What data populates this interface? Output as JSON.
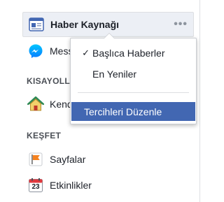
{
  "sidebar": {
    "news_feed": {
      "label": "Haber Kaynağı",
      "more": "•••"
    },
    "messenger": {
      "label": "Messenger"
    },
    "shortcuts_title": "KISAYOLLAR",
    "shortcut_item": {
      "label": "Kendin"
    },
    "explore_title": "KEŞFET",
    "pages": {
      "label": "Sayfalar"
    },
    "events": {
      "label": "Etkinlikler",
      "day": "23"
    }
  },
  "dropdown": {
    "items": [
      {
        "label": "Başlıca Haberler",
        "checked": true
      },
      {
        "label": "En Yeniler",
        "checked": false
      }
    ],
    "edit_preferences": "Tercihleri Düzenle",
    "check_mark": "✓"
  },
  "colors": {
    "accent": "#4267b2",
    "selected_bg": "#eceff5",
    "text": "#1d2129",
    "section_text": "#4b4f56"
  }
}
